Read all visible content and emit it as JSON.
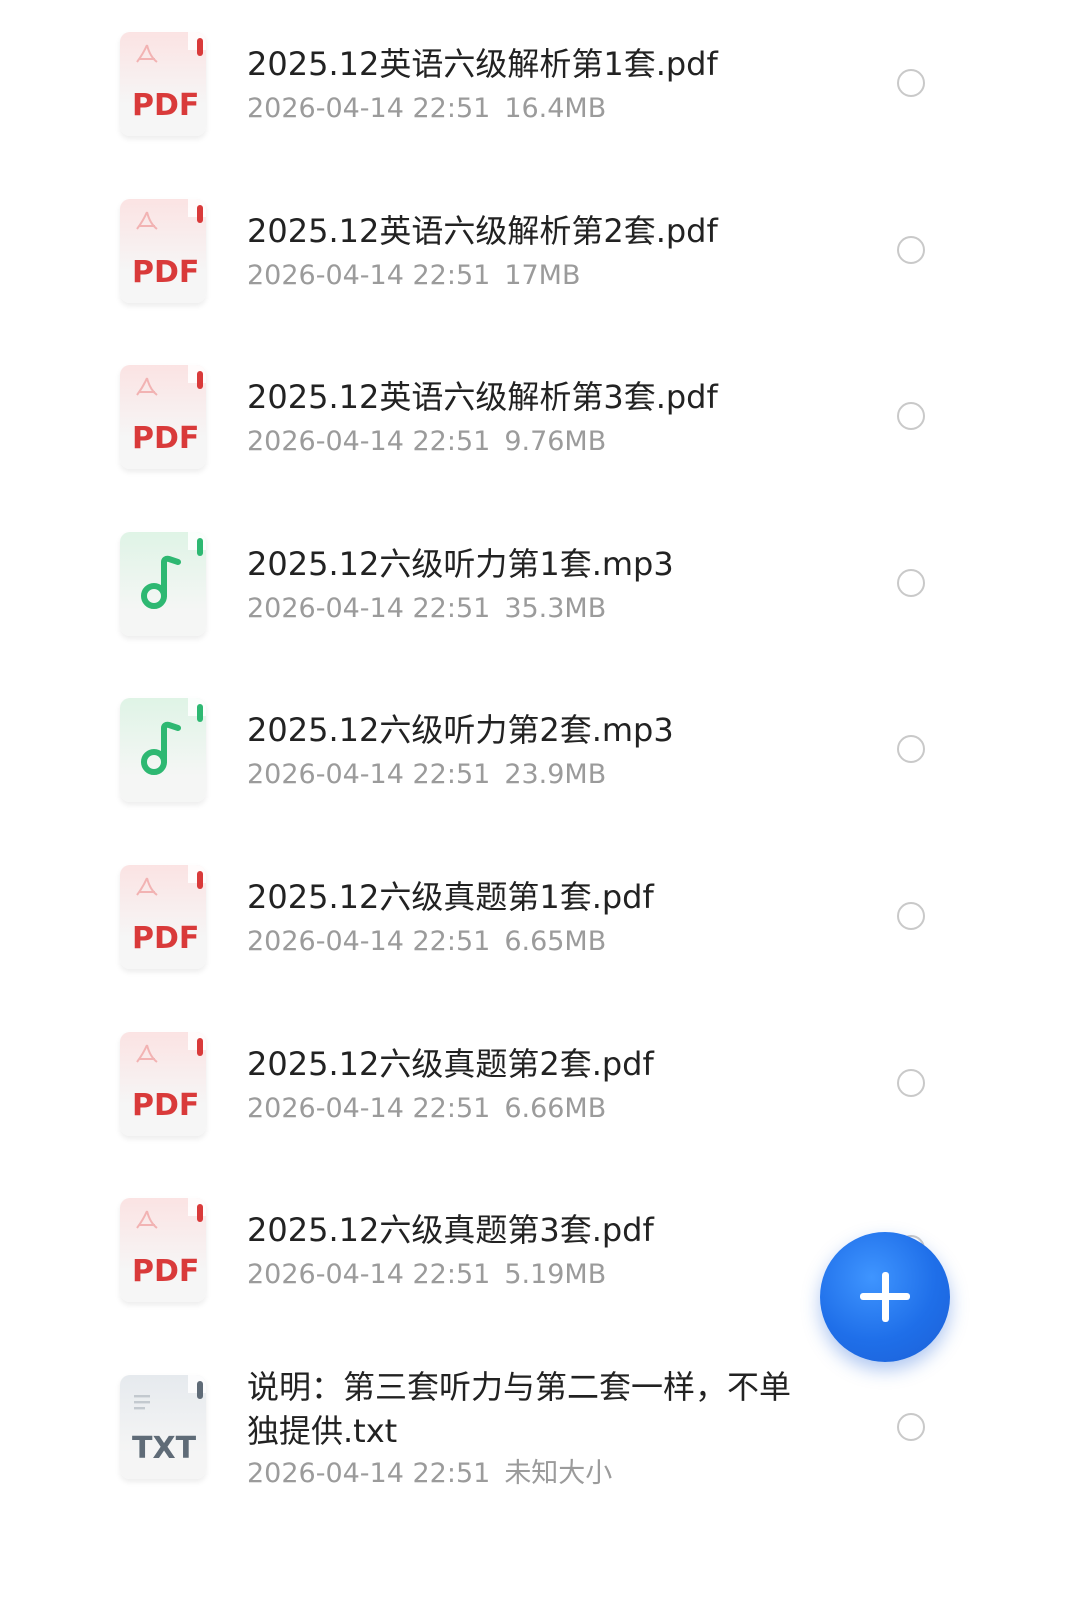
{
  "colors": {
    "pdf_accent": "#d93a3a",
    "pdf_bg_top": "#fbe3e3",
    "pdf_bg_bottom": "#f6f6f6",
    "audio_accent": "#2eb872",
    "audio_bg_top": "#dff4e6",
    "audio_bg_bottom": "#f5f6f5",
    "txt_accent": "#5f6b77",
    "txt_bg_top": "#e6eaee",
    "txt_bg_bottom": "#f5f5f5",
    "fab": "#1f6fe9",
    "name_text": "#222222",
    "meta_text": "#9b9b9b",
    "radio_border": "#c9c9c9"
  },
  "files": [
    {
      "icon": "pdf-icon",
      "type_label": "PDF",
      "name": "2025.12英语六级解析第1套.pdf",
      "date": "2026-04-14 22:51",
      "size": "16.4MB"
    },
    {
      "icon": "pdf-icon",
      "type_label": "PDF",
      "name": "2025.12英语六级解析第2套.pdf",
      "date": "2026-04-14 22:51",
      "size": "17MB"
    },
    {
      "icon": "pdf-icon",
      "type_label": "PDF",
      "name": "2025.12英语六级解析第3套.pdf",
      "date": "2026-04-14 22:51",
      "size": "9.76MB"
    },
    {
      "icon": "music-note-icon",
      "type_label": "",
      "name": "2025.12六级听力第1套.mp3",
      "date": "2026-04-14 22:51",
      "size": "35.3MB"
    },
    {
      "icon": "music-note-icon",
      "type_label": "",
      "name": "2025.12六级听力第2套.mp3",
      "date": "2026-04-14 22:51",
      "size": "23.9MB"
    },
    {
      "icon": "pdf-icon",
      "type_label": "PDF",
      "name": "2025.12六级真题第1套.pdf",
      "date": "2026-04-14 22:51",
      "size": "6.65MB"
    },
    {
      "icon": "pdf-icon",
      "type_label": "PDF",
      "name": "2025.12六级真题第2套.pdf",
      "date": "2026-04-14 22:51",
      "size": "6.66MB"
    },
    {
      "icon": "pdf-icon",
      "type_label": "PDF",
      "name": "2025.12六级真题第3套.pdf",
      "date": "2026-04-14 22:51",
      "size": "5.19MB"
    },
    {
      "icon": "txt-icon",
      "type_label": "TXT",
      "name": "说明：第三套听力与第二套一样，不单独提供.txt",
      "date": "2026-04-14 22:51",
      "size": "未知大小"
    }
  ],
  "fab": {
    "icon": "plus-icon"
  }
}
